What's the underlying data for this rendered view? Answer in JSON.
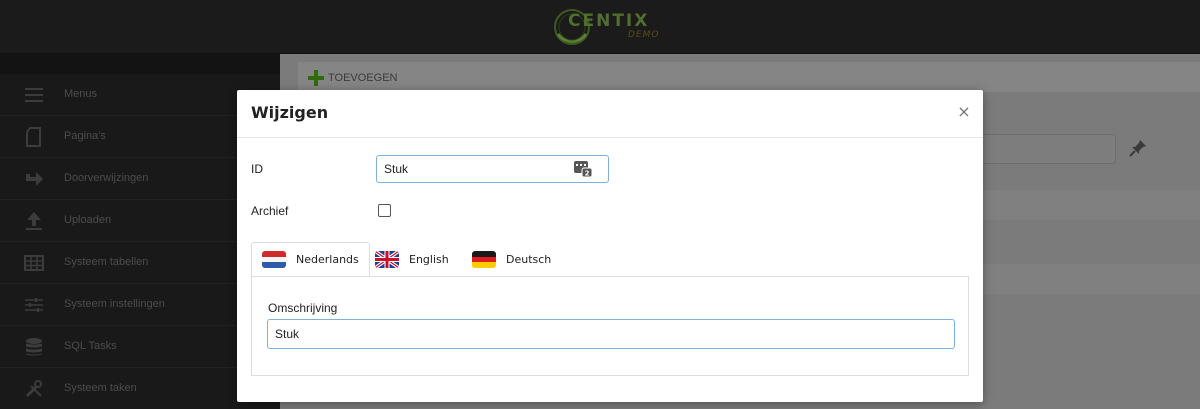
{
  "header": {
    "logo_text": "CENTIX",
    "logo_sub": "DEMO",
    "accent_green": "#4f6f2e"
  },
  "sidebar": {
    "items": [
      {
        "label": "Menus",
        "icon": "menu-icon"
      },
      {
        "label": "Pagina's",
        "icon": "page-icon"
      },
      {
        "label": "Doorverwijzingen",
        "icon": "redirect-arrow-icon"
      },
      {
        "label": "Uploaden",
        "icon": "upload-icon"
      },
      {
        "label": "Systeem tabellen",
        "icon": "table-icon"
      },
      {
        "label": "Systeem instellingen",
        "icon": "sliders-icon"
      },
      {
        "label": "SQL Tasks",
        "icon": "database-icon"
      },
      {
        "label": "Systeem taken",
        "icon": "tools-icon"
      }
    ]
  },
  "main": {
    "add_label": "TOEVOEGEN"
  },
  "modal": {
    "title": "Wijzigen",
    "close_symbol": "×",
    "id_label": "ID",
    "id_value": "Stuk",
    "archive_label": "Archief",
    "archive_checked": false,
    "tabs": [
      {
        "label": "Nederlands",
        "flag": "flag-nl-icon",
        "active": true
      },
      {
        "label": "English",
        "flag": "flag-uk-icon",
        "active": false
      },
      {
        "label": "Deutsch",
        "flag": "flag-de-icon",
        "active": false
      }
    ],
    "description_label": "Omschrijving",
    "description_value": "Stuk"
  }
}
